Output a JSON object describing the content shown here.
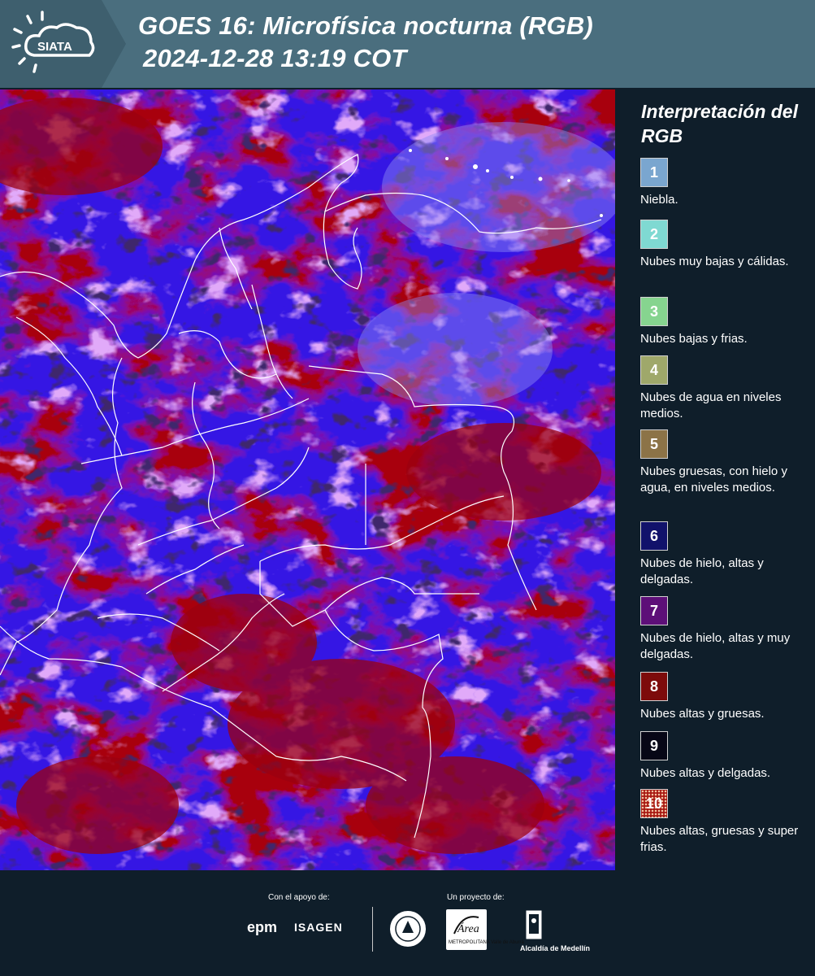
{
  "header": {
    "logo_text": "SIATA",
    "title_line1": "GOES 16: Microfísica nocturna (RGB)",
    "title_line2": "2024-12-28 13:19 COT"
  },
  "legend": {
    "title": "Interpretación del RGB",
    "items": [
      {
        "number": "1",
        "color": "#7aa6cf",
        "text": "Niebla."
      },
      {
        "number": "2",
        "color": "#7fd9d2",
        "text": "Nubes muy bajas y cálidas."
      },
      {
        "number": "3",
        "color": "#86d48f",
        "text": "Nubes bajas y frias."
      },
      {
        "number": "4",
        "color": "#9fa86a",
        "text": "Nubes de agua en niveles medios."
      },
      {
        "number": "5",
        "color": "#8c7347",
        "text": "Nubes gruesas, con hielo y agua, en niveles medios."
      },
      {
        "number": "6",
        "color": "#11126b",
        "text": "Nubes de hielo, altas y delgadas."
      },
      {
        "number": "7",
        "color": "#5d0f78",
        "text": "Nubes de hielo, altas y muy delgadas."
      },
      {
        "number": "8",
        "color": "#7d0b0b",
        "text": "Nubes altas y gruesas."
      },
      {
        "number": "9",
        "color": "#070716",
        "text": "Nubes altas y delgadas."
      },
      {
        "number": "10",
        "color": "#a81812",
        "text": "Nubes altas, gruesas y super frias."
      }
    ]
  },
  "footer": {
    "support_label": "Con el apoyo de:",
    "project_label": "Un proyecto de:",
    "sponsors": [
      "epm",
      "ISAGEN"
    ],
    "area_logo_text": "METROPOLITANA Valle de Aburrá",
    "alcaldia_text": "Alcaldía de Medellín"
  }
}
